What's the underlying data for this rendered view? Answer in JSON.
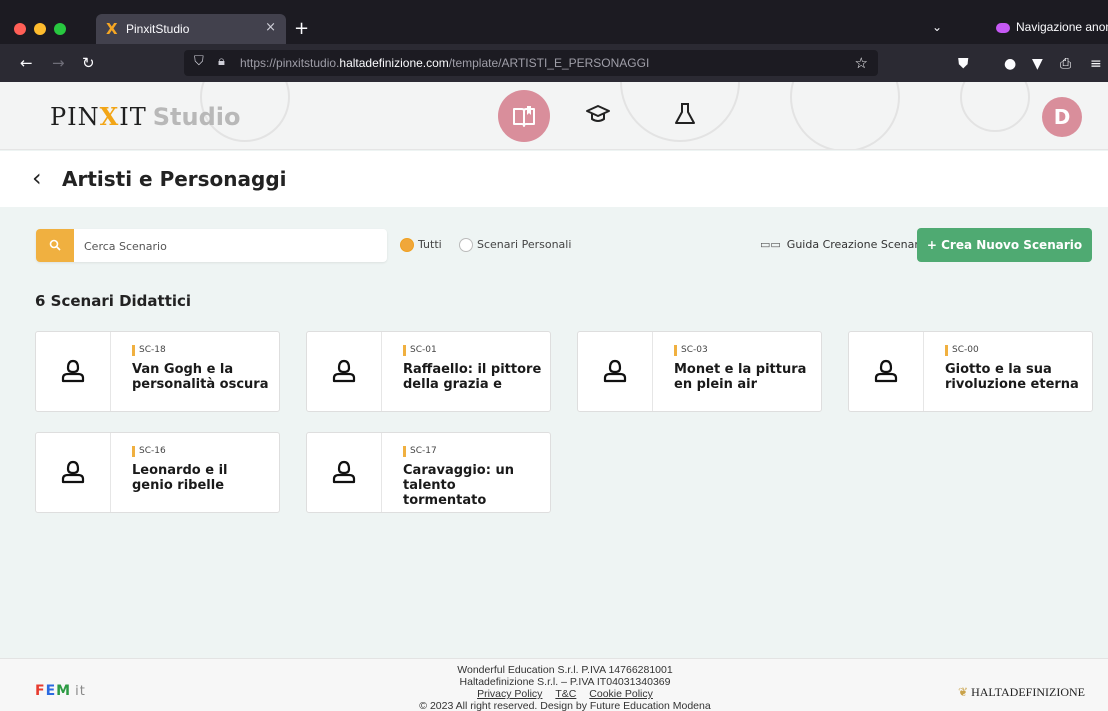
{
  "browser": {
    "tab_title": "PinxitStudio",
    "tab_close": "×",
    "new_tab": "+",
    "private_label": "Navigazione anonima",
    "url_prefix": "https://pinxitstudio.",
    "url_domain": "haltadefinizione.com",
    "url_path": "/template/ARTISTI_E_PERSONAGGI"
  },
  "header": {
    "logo_text_a": "PIN",
    "logo_text_x": "X",
    "logo_text_b": "IT",
    "logo_studio": "Studio",
    "avatar_letter": "D"
  },
  "page": {
    "back_icon": "‹",
    "title": "Artisti e Personaggi"
  },
  "toolbar": {
    "search_placeholder": "Cerca Scenario",
    "radio_all": "Tutti",
    "radio_personal": "Scenari Personali",
    "guide_label": "Guida Creazione Scenari",
    "create_label": "+ Crea Nuovo Scenario"
  },
  "scenarios": {
    "count_label": "6 Scenari Didattici",
    "items": [
      {
        "code": "SC-18",
        "title": "Van Gogh e la personalità oscura"
      },
      {
        "code": "SC-01",
        "title": "Raffaello: il pittore della grazia e"
      },
      {
        "code": "SC-03",
        "title": "Monet e la pittura en plein air"
      },
      {
        "code": "SC-00",
        "title": "Giotto e la sua rivoluzione eterna"
      },
      {
        "code": "SC-16",
        "title": "Leonardo e il genio ribelle"
      },
      {
        "code": "SC-17",
        "title": "Caravaggio: un talento tormentato"
      }
    ]
  },
  "footer": {
    "line1": "Wonderful Education S.r.l. P.IVA 14766281001",
    "line2": "Haltadefinizione S.r.l. – P.IVA IT04031340369",
    "privacy": "Privacy Policy",
    "tc": "T&C",
    "cookie": "Cookie Policy",
    "line4": "© 2023 All right reserved. Design by Future Education Modena",
    "fem_f": "F",
    "fem_e": "E",
    "fem_m": "M",
    "fem_it": "it",
    "halta_logo": "HALTADEFINIZIONE"
  },
  "colors": {
    "accent_pink": "#d98e9b",
    "accent_orange": "#f0b040",
    "create_green": "#4faa72"
  }
}
